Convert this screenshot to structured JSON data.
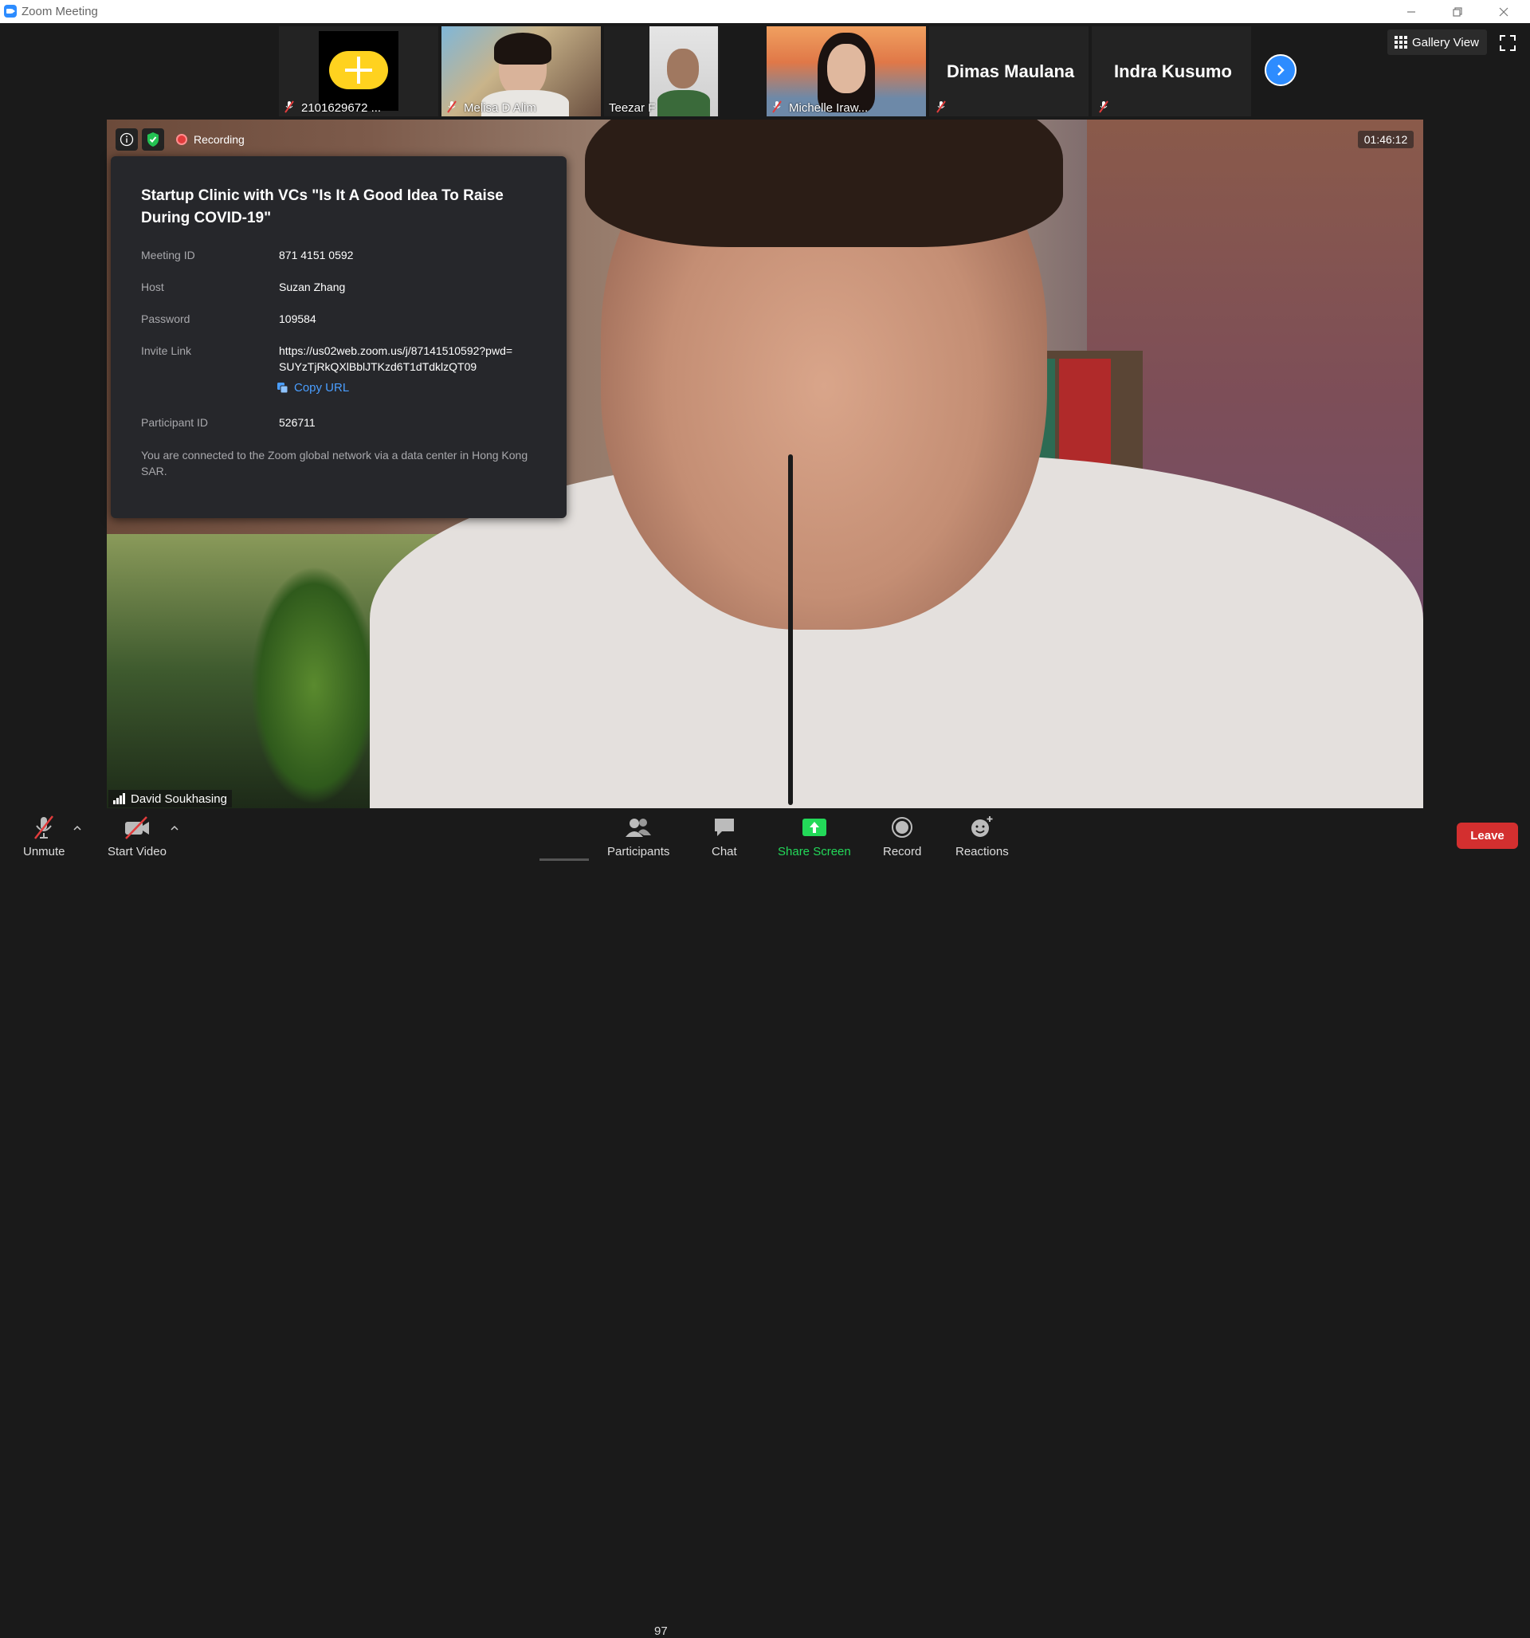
{
  "window": {
    "title": "Zoom Meeting"
  },
  "participants_strip": [
    {
      "name": "2101629672 ...",
      "muted": true
    },
    {
      "name": "Melisa D Alim",
      "muted": true
    },
    {
      "name": "Teezar F",
      "muted": false
    },
    {
      "name": "Michelle Iraw...",
      "muted": true
    },
    {
      "name": "Dimas Maulana",
      "muted": true
    },
    {
      "name": "Indra Kusumo",
      "muted": true
    }
  ],
  "view": {
    "gallery_label": "Gallery View"
  },
  "recording": {
    "label": "Recording",
    "elapsed": "01:46:12"
  },
  "meeting_info": {
    "title": "Startup Clinic with VCs \"Is It A Good Idea To Raise During COVID-19\"",
    "meeting_id_label": "Meeting ID",
    "meeting_id": "871 4151 0592",
    "host_label": "Host",
    "host": "Suzan Zhang",
    "password_label": "Password",
    "password": "109584",
    "invite_label": "Invite Link",
    "invite_line1": "https://us02web.zoom.us/j/87141510592?pwd=",
    "invite_line2": "SUYzTjRkQXlBblJTKzd6T1dTdklzQT09",
    "copy_url": "Copy URL",
    "participant_id_label": "Participant ID",
    "participant_id": "526711",
    "network_note": "You are connected to the Zoom global network via a data center in Hong Kong SAR."
  },
  "active_speaker": {
    "name": "David Soukhasing"
  },
  "toolbar": {
    "unmute": "Unmute",
    "start_video": "Start Video",
    "participants": "Participants",
    "participants_count": "97",
    "chat": "Chat",
    "share_screen": "Share Screen",
    "record": "Record",
    "reactions": "Reactions",
    "leave": "Leave"
  },
  "colors": {
    "accent": "#2d8cff",
    "share_green": "#23d959",
    "leave_red": "#d32f2f",
    "recording_red": "#e23c3c"
  }
}
